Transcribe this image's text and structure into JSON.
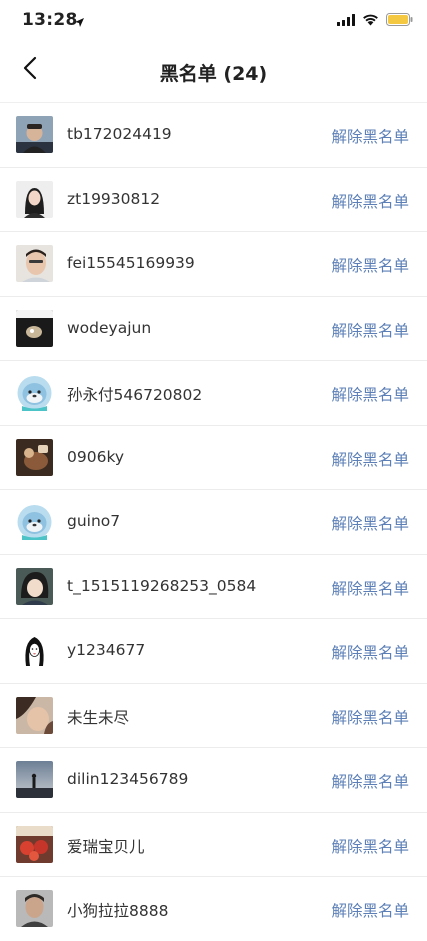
{
  "status_bar": {
    "time": "13:28"
  },
  "nav": {
    "title": "黑名单 (24)"
  },
  "colors": {
    "link": "#5b7fb6",
    "battery": "#f5c842"
  },
  "users": [
    {
      "name": "tb172024419",
      "action": "解除黑名单",
      "avatar_icon": "man-portrait-icon"
    },
    {
      "name": "zt19930812",
      "action": "解除黑名单",
      "avatar_icon": "woman-portrait-icon"
    },
    {
      "name": "fei15545169939",
      "action": "解除黑名单",
      "avatar_icon": "man-selfie-icon"
    },
    {
      "name": "wodeyajun",
      "action": "解除黑名单",
      "avatar_icon": "dark-photo-icon"
    },
    {
      "name": "孙永付546720802",
      "action": "解除黑名单",
      "avatar_icon": "seal-cartoon-icon"
    },
    {
      "name": "0906ky",
      "action": "解除黑名单",
      "avatar_icon": "food-photo-icon"
    },
    {
      "name": "guino7",
      "action": "解除黑名单",
      "avatar_icon": "seal-cartoon-icon"
    },
    {
      "name": "t_1515119268253_0584",
      "action": "解除黑名单",
      "avatar_icon": "anime-character-icon"
    },
    {
      "name": "y1234677",
      "action": "解除黑名单",
      "avatar_icon": "ink-drawing-girl-icon"
    },
    {
      "name": "未生未尽",
      "action": "解除黑名单",
      "avatar_icon": "face-photo-icon"
    },
    {
      "name": "dilin123456789",
      "action": "解除黑名单",
      "avatar_icon": "silhouette-landscape-icon"
    },
    {
      "name": "爱瑞宝贝儿",
      "action": "解除黑名单",
      "avatar_icon": "red-food-photo-icon"
    },
    {
      "name": "小狗拉拉8888",
      "action": "解除黑名单",
      "avatar_icon": "man-portrait-icon"
    }
  ]
}
